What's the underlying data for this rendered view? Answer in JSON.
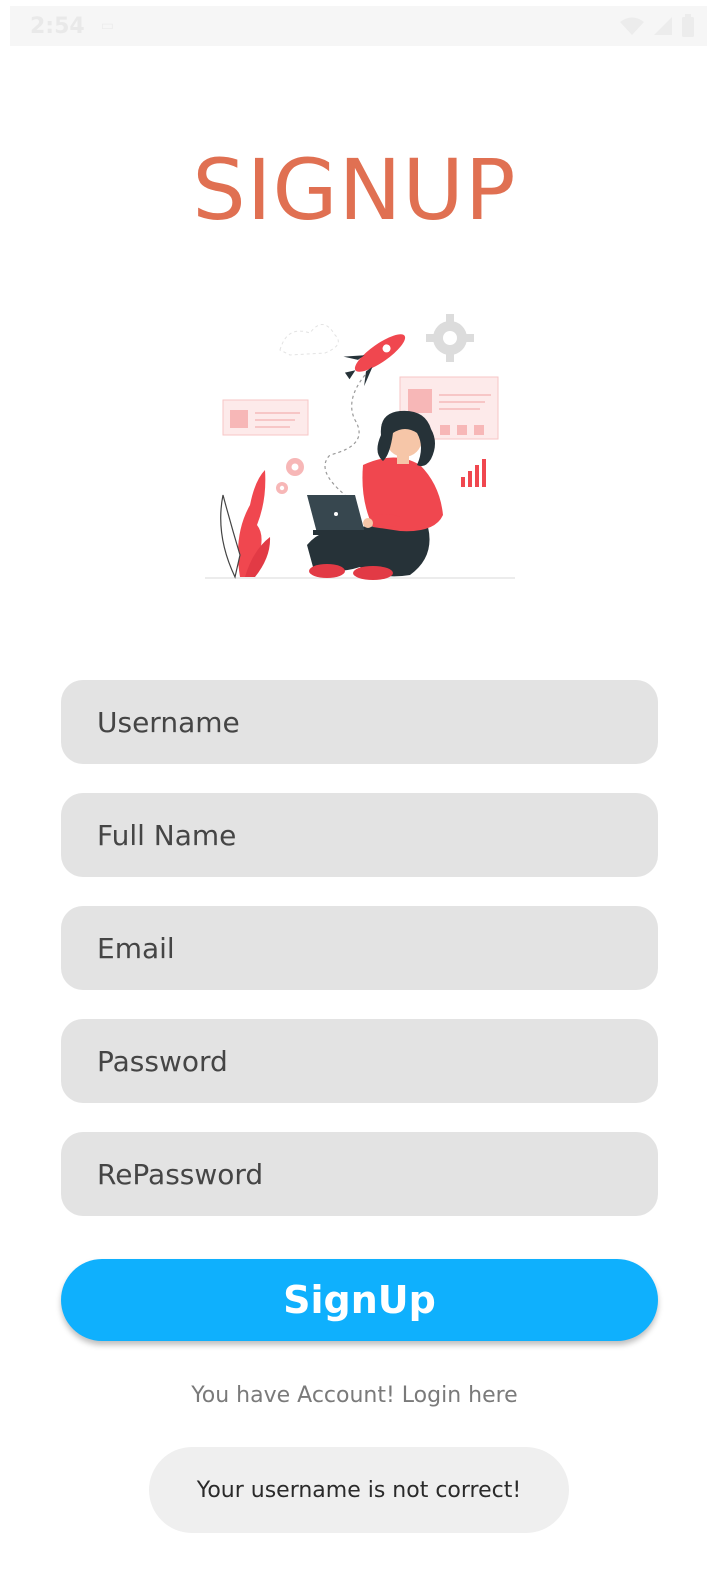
{
  "status_bar": {
    "time": "2:54",
    "app_icon": "sd-card-icon",
    "icons": [
      "wifi-icon",
      "signal-icon",
      "battery-icon"
    ]
  },
  "title": "SIGNUP",
  "illustration": {
    "icon": "person-with-laptop-illustration"
  },
  "form": {
    "username_placeholder": "Username",
    "fullname_placeholder": "Full Name",
    "email_placeholder": "Email",
    "password_placeholder": "Password",
    "repassword_placeholder": "RePassword"
  },
  "signup_button_label": "SignUp",
  "login_link_text": "You have Account! Login here",
  "toast_message": "Your username is not correct!",
  "colors": {
    "title": "#e07052",
    "button": "#0fb0fd",
    "field_background": "#e3e3e3",
    "illustration_accent": "#f0474f"
  }
}
